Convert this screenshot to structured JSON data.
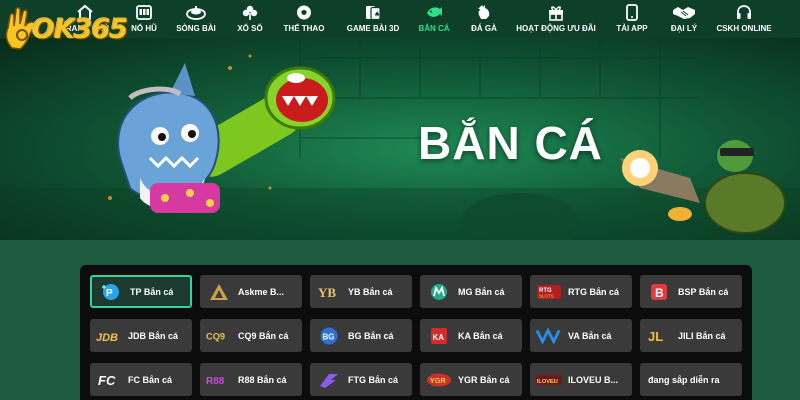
{
  "brand": {
    "logo_text": "OK365"
  },
  "nav": {
    "items": [
      {
        "label": "TRANG CHỦ",
        "icon": "home-icon"
      },
      {
        "label": "NỔ HŨ",
        "icon": "slot-machine-icon"
      },
      {
        "label": "SÒNG BÀI",
        "icon": "casino-chip-icon"
      },
      {
        "label": "XỔ SỐ",
        "icon": "clover-icon"
      },
      {
        "label": "THỂ THAO",
        "icon": "soccer-ball-icon"
      },
      {
        "label": "GAME BÀI 3D",
        "icon": "cards-icon"
      },
      {
        "label": "BẮN CÁ",
        "icon": "fish-icon",
        "active": true
      },
      {
        "label": "ĐÁ GÀ",
        "icon": "rooster-icon"
      },
      {
        "label": "HOẠT ĐỘNG ƯU ĐÃI",
        "icon": "gift-icon"
      },
      {
        "label": "TẢI APP",
        "icon": "phone-icon"
      },
      {
        "label": "ĐẠI LÝ",
        "icon": "handshake-icon"
      },
      {
        "label": "CSKH ONLINE",
        "icon": "headset-icon"
      }
    ],
    "active_color": "#2ee08a"
  },
  "banner": {
    "title": "BẮN CÁ"
  },
  "providers": [
    {
      "label": "TP Bắn cá",
      "logo": "TP",
      "active": true
    },
    {
      "label": "Askme B...",
      "logo": "A"
    },
    {
      "label": "YB Bắn cá",
      "logo": "YB"
    },
    {
      "label": "MG Bắn cá",
      "logo": "M"
    },
    {
      "label": "RTG Bắn cá",
      "logo": "RTG SLOTS"
    },
    {
      "label": "BSP Bắn cá",
      "logo": "B"
    },
    {
      "label": "JDB Bắn cá",
      "logo": "JDB"
    },
    {
      "label": "CQ9 Bắn cá",
      "logo": "CQ9"
    },
    {
      "label": "BG Bắn cá",
      "logo": "BG"
    },
    {
      "label": "KA Bắn cá",
      "logo": "KA"
    },
    {
      "label": "VA Bắn cá",
      "logo": "VA"
    },
    {
      "label": "JILI Bắn cá",
      "logo": "JL"
    },
    {
      "label": "FC Bắn cá",
      "logo": "FC"
    },
    {
      "label": "R88 Bắn cá",
      "logo": "R88"
    },
    {
      "label": "FTG Bắn cá",
      "logo": "FTG"
    },
    {
      "label": "YGR Bắn cá",
      "logo": "YGR"
    },
    {
      "label": "ILOVEU B...",
      "logo": "ILOVEU"
    },
    {
      "label": "đang sắp diễn ra",
      "logo": ""
    }
  ]
}
